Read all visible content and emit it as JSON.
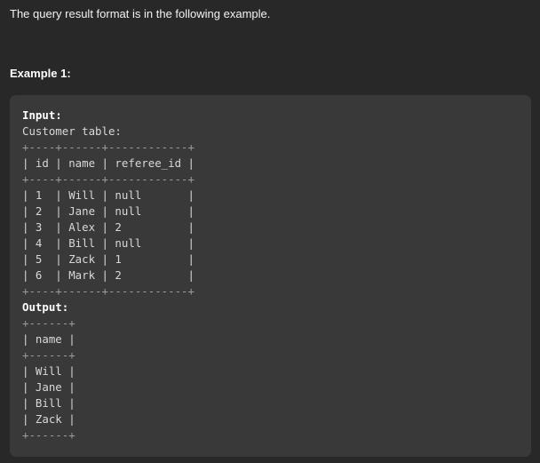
{
  "intro_text": "The query result format is in the following example.",
  "example": {
    "heading": "Example 1:",
    "input_label": "Input:",
    "table_caption": "Customer table:",
    "input_table": {
      "border_top": "+----+------+------------+",
      "header": "| id | name | referee_id |",
      "border_mid": "+----+------+------------+",
      "rows": [
        "| 1  | Will | null       |",
        "| 2  | Jane | null       |",
        "| 3  | Alex | 2          |",
        "| 4  | Bill | null       |",
        "| 5  | Zack | 1          |",
        "| 6  | Mark | 2          |"
      ],
      "border_bottom": "+----+------+------------+"
    },
    "output_label": "Output:",
    "output_table": {
      "border_top": "+------+",
      "header": "| name |",
      "border_mid": "+------+",
      "rows": [
        "| Will |",
        "| Jane |",
        "| Bill |",
        "| Zack |"
      ],
      "border_bottom": "+------+"
    }
  }
}
